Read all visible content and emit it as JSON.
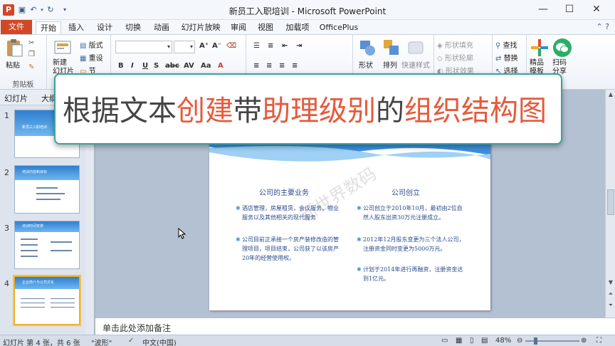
{
  "window": {
    "title": "新员工入职培训 - Microsoft PowerPoint",
    "app_icon": "P",
    "controls": [
      "?",
      "—",
      "☐",
      "✕"
    ]
  },
  "tabs": [
    {
      "label": "文件"
    },
    {
      "label": "开始"
    },
    {
      "label": "插入"
    },
    {
      "label": "设计"
    },
    {
      "label": "切换"
    },
    {
      "label": "动画"
    },
    {
      "label": "幻灯片放映"
    },
    {
      "label": "审阅"
    },
    {
      "label": "视图"
    },
    {
      "label": "加载项"
    },
    {
      "label": "OfficePlus"
    }
  ],
  "ribbon": {
    "paste": "粘贴",
    "clipboard": "剪贴板",
    "new_slide": "新建\n幻灯片",
    "layout": "版式",
    "reset": "重设",
    "section": "节",
    "shape": "形状",
    "arrange": "排列",
    "quick_style": "快速样式",
    "shape_fill": "形状填充",
    "shape_outline": "形状轮廓",
    "shape_effect": "形状效果",
    "find": "查找",
    "replace": "替换",
    "select": "选择",
    "premium": "精品\n模板",
    "scan_share": "扫码\n分享"
  },
  "left_panel": {
    "tabs": [
      "幻灯片",
      "大纲"
    ],
    "slides": [
      {
        "num": "1",
        "title": "新员工入职培训"
      },
      {
        "num": "2",
        "title": "培训内容和目标"
      },
      {
        "num": "3",
        "title": "培训时间安排"
      },
      {
        "num": "4",
        "title": "企业简介与公司文化"
      }
    ]
  },
  "slide": {
    "left_title": "公司的主要业务",
    "right_title": "公司创立",
    "left_bullets": [
      "酒店管理，房屋租赁，会议服务，物业服务以及其他相关的现代服务",
      "公司目前正承接一个房产装修改造的管理项目，项目结束，公司获了以该房产20年的经营使用权。"
    ],
    "right_bullets": [
      "公司创立于2010年10月，最初由2位自然人股东出资30万元注册成立。",
      "2012年12月股东变更为三个法人公司，注册资金同时变更为5000万元。",
      "计划于2014年进行再融资，注册资金达到1亿元。"
    ],
    "watermark": "新世界数码"
  },
  "notes_placeholder": "单击此处添加备注",
  "status": {
    "slide_info": "幻灯片 第 4 张，共 6 张",
    "theme": "\"波形\"",
    "language": "中文(中国)",
    "zoom": "48%"
  },
  "banner": {
    "parts": [
      {
        "text": "根据文本",
        "color": "dark"
      },
      {
        "text": "创建",
        "color": "red"
      },
      {
        "text": "带",
        "color": "dark"
      },
      {
        "text": "助理级别",
        "color": "red"
      },
      {
        "text": "的",
        "color": "dark"
      },
      {
        "text": "组织结构图",
        "color": "red"
      }
    ]
  }
}
